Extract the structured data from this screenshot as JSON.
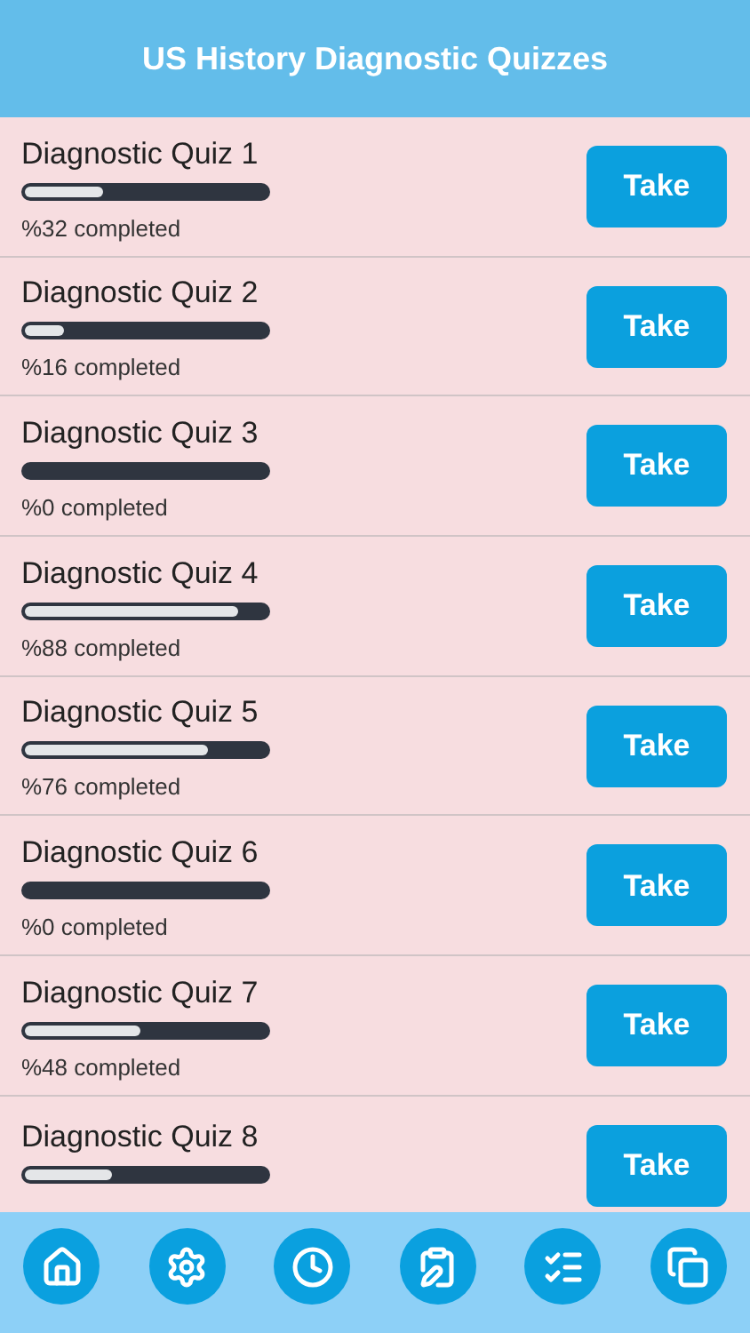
{
  "header": {
    "title": "US History Diagnostic Quizzes"
  },
  "quizzes": [
    {
      "title": "Diagnostic Quiz 1",
      "level": 0.32,
      "progress": "%32 completed",
      "button": "Take"
    },
    {
      "title": "Diagnostic Quiz 2",
      "level": 0.16,
      "progress": "%16 completed",
      "button": "Take"
    },
    {
      "title": "Diagnostic Quiz 3",
      "level": 0,
      "progress": "%0 completed",
      "button": "Take"
    },
    {
      "title": "Diagnostic Quiz 4",
      "level": 0.88,
      "progress": "%88 completed",
      "button": "Take"
    },
    {
      "title": "Diagnostic Quiz 5",
      "level": 0.76,
      "progress": "%76 completed",
      "button": "Take"
    },
    {
      "title": "Diagnostic Quiz 6",
      "level": 0,
      "progress": "%0 completed",
      "button": "Take"
    },
    {
      "title": "Diagnostic Quiz 7",
      "level": 0.48,
      "progress": "%48 completed",
      "button": "Take"
    },
    {
      "title": "Diagnostic Quiz 8",
      "level": 0.36,
      "button": "Take"
    }
  ],
  "tab_bar": [
    {
      "kind": "home"
    },
    {
      "kind": "settings"
    },
    {
      "kind": "clock"
    },
    {
      "kind": "edit"
    },
    {
      "kind": "list"
    },
    {
      "kind": "copy"
    }
  ]
}
